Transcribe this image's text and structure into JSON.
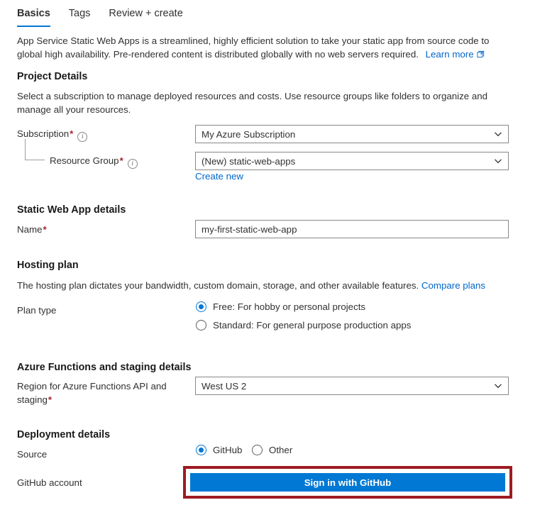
{
  "tabs": [
    {
      "label": "Basics",
      "active": true
    },
    {
      "label": "Tags",
      "active": false
    },
    {
      "label": "Review + create",
      "active": false
    }
  ],
  "intro": {
    "text": "App Service Static Web Apps is a streamlined, highly efficient solution to take your static app from source code to global high availability. Pre-rendered content is distributed globally with no web servers required.",
    "learn_more": "Learn more",
    "learn_more_icon": "external-link-icon"
  },
  "project_details": {
    "heading": "Project Details",
    "description": "Select a subscription to manage deployed resources and costs. Use resource groups like folders to organize and manage all your resources.",
    "subscription": {
      "label": "Subscription",
      "required": "*",
      "info_icon": "info-icon",
      "value": "My Azure Subscription"
    },
    "resource_group": {
      "label": "Resource Group",
      "required": "*",
      "info_icon": "info-icon",
      "value": "(New) static-web-apps",
      "create_new": "Create new"
    }
  },
  "static_web_app_details": {
    "heading": "Static Web App details",
    "name": {
      "label": "Name",
      "required": "*",
      "value": "my-first-static-web-app",
      "placeholder": ""
    }
  },
  "hosting_plan": {
    "heading": "Hosting plan",
    "description": "The hosting plan dictates your bandwidth, custom domain, storage, and other available features.",
    "compare_plans": "Compare plans",
    "plan_type_label": "Plan type",
    "options": [
      {
        "label": "Free: For hobby or personal projects",
        "selected": true
      },
      {
        "label": "Standard: For general purpose production apps",
        "selected": false
      }
    ]
  },
  "azure_functions": {
    "heading": "Azure Functions and staging details",
    "region": {
      "label": "Region for Azure Functions API and staging",
      "required": "*",
      "value": "West US 2"
    }
  },
  "deployment_details": {
    "heading": "Deployment details",
    "source_label": "Source",
    "source_options": [
      {
        "label": "GitHub",
        "selected": true
      },
      {
        "label": "Other",
        "selected": false
      }
    ],
    "github_account_label": "GitHub account",
    "sign_in_button": "Sign in with GitHub"
  },
  "colors": {
    "accent": "#0078d4",
    "link": "#0066cc",
    "required_asterisk": "#a4262c",
    "highlight_border": "#9e1b22",
    "text": "#323130",
    "border": "#8a8886"
  }
}
